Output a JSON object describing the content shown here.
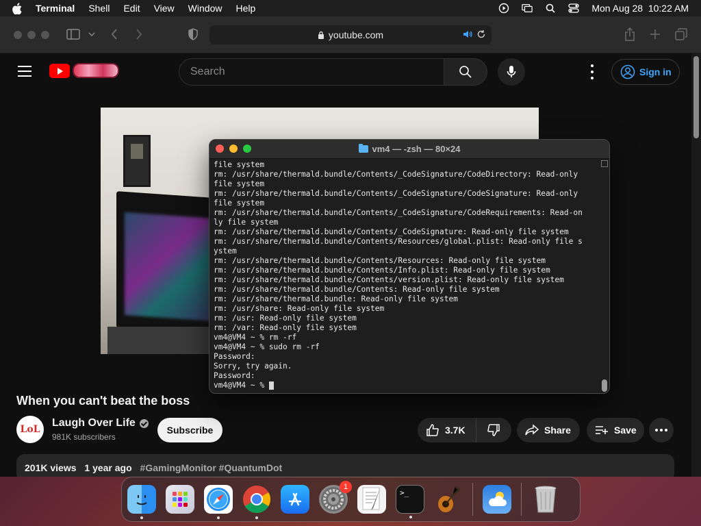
{
  "menubar": {
    "app_name": "Terminal",
    "items": [
      "Shell",
      "Edit",
      "View",
      "Window",
      "Help"
    ],
    "datetime": "Mon Aug 28  10:22 AM"
  },
  "safari": {
    "url": "youtube.com"
  },
  "youtube": {
    "search_placeholder": "Search",
    "signin_label": "Sign in",
    "video_title": "When you can't beat the boss",
    "channel_name": "Laugh Over Life",
    "channel_avatar_text": "LoL",
    "channel_subs": "981K subscribers",
    "subscribe_label": "Subscribe",
    "like_count": "3.7K",
    "share_label": "Share",
    "save_label": "Save",
    "views": "201K views",
    "posted": "1 year ago",
    "tags": "#GamingMonitor #QuantumDot"
  },
  "terminal": {
    "title": "vm4 — -zsh — 80×24",
    "lines": [
      "file system",
      "rm: /usr/share/thermald.bundle/Contents/_CodeSignature/CodeDirectory: Read-only",
      "file system",
      "rm: /usr/share/thermald.bundle/Contents/_CodeSignature/CodeSignature: Read-only",
      "file system",
      "rm: /usr/share/thermald.bundle/Contents/_CodeSignature/CodeRequirements: Read-on",
      "ly file system",
      "rm: /usr/share/thermald.bundle/Contents/_CodeSignature: Read-only file system",
      "rm: /usr/share/thermald.bundle/Contents/Resources/global.plist: Read-only file s",
      "ystem",
      "rm: /usr/share/thermald.bundle/Contents/Resources: Read-only file system",
      "rm: /usr/share/thermald.bundle/Contents/Info.plist: Read-only file system",
      "rm: /usr/share/thermald.bundle/Contents/version.plist: Read-only file system",
      "rm: /usr/share/thermald.bundle/Contents: Read-only file system",
      "rm: /usr/share/thermald.bundle: Read-only file system",
      "rm: /usr/share: Read-only file system",
      "rm: /usr: Read-only file system",
      "rm: /var: Read-only file system",
      "vm4@VM4 ~ % rm -rf",
      "vm4@VM4 ~ % sudo rm -rf",
      "Password:",
      "Sorry, try again.",
      "Password:",
      "vm4@VM4 ~ % "
    ]
  },
  "dock": {
    "apps": [
      {
        "name": "finder-app",
        "running": true
      },
      {
        "name": "launchpad-app",
        "running": false
      },
      {
        "name": "safari-app",
        "running": true
      },
      {
        "name": "chrome-app",
        "running": true
      },
      {
        "name": "app-store-app",
        "running": false
      },
      {
        "name": "system-settings-app",
        "running": false,
        "badge": "1"
      },
      {
        "name": "textedit-app",
        "running": false
      },
      {
        "name": "terminal-app",
        "running": true
      },
      {
        "name": "garageband-app",
        "running": false
      },
      {
        "name": "weather-app",
        "running": false
      },
      {
        "name": "trash-app",
        "running": false
      }
    ],
    "terminal_icon_text": ">_"
  },
  "colors": {
    "yt_blue": "#3ea6ff",
    "yt_red": "#ff0000",
    "badge_red": "#ff3b30"
  }
}
